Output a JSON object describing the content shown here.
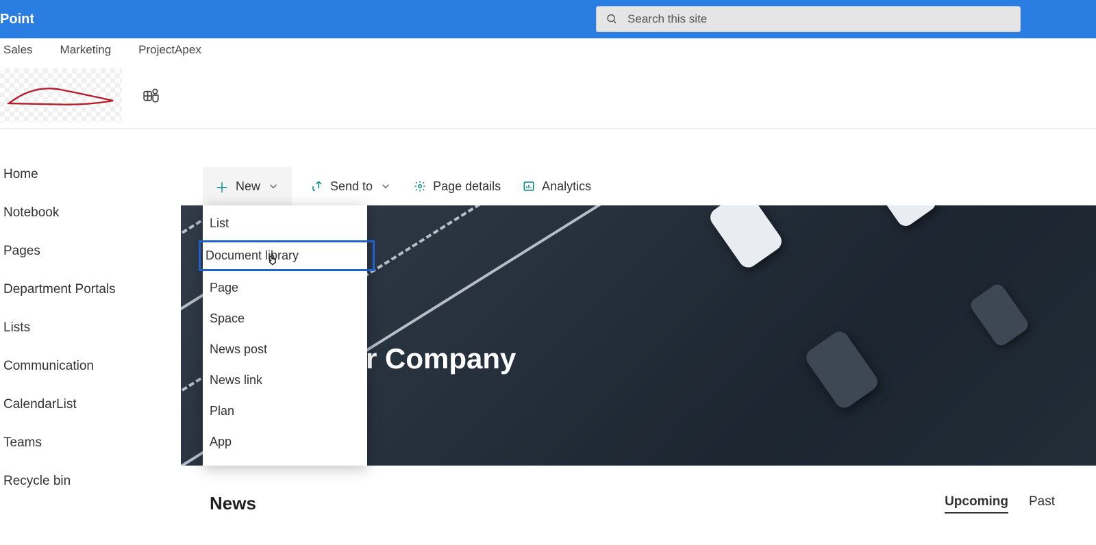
{
  "topbar": {
    "app_title": "arePoint",
    "search_placeholder": "Search this site"
  },
  "linkrow": [
    "Sales",
    "Marketing",
    "ProjectApex"
  ],
  "leftnav": [
    "Home",
    "Notebook",
    "Pages",
    "Department Portals",
    "Lists",
    "Communication",
    "CalendarList",
    "Teams",
    "Recycle bin"
  ],
  "cmdbar": {
    "new": "New",
    "sendto": "Send to",
    "pagedetails": "Page details",
    "analytics": "Analytics"
  },
  "dropdown": [
    "List",
    "Document library",
    "Page",
    "Space",
    "News post",
    "News link",
    "Plan",
    "App"
  ],
  "dropdown_selected_index": 1,
  "hero": {
    "title": "r Company"
  },
  "news": {
    "heading": "News",
    "tabs": [
      "Upcoming",
      "Past"
    ],
    "active_tab_index": 0
  }
}
